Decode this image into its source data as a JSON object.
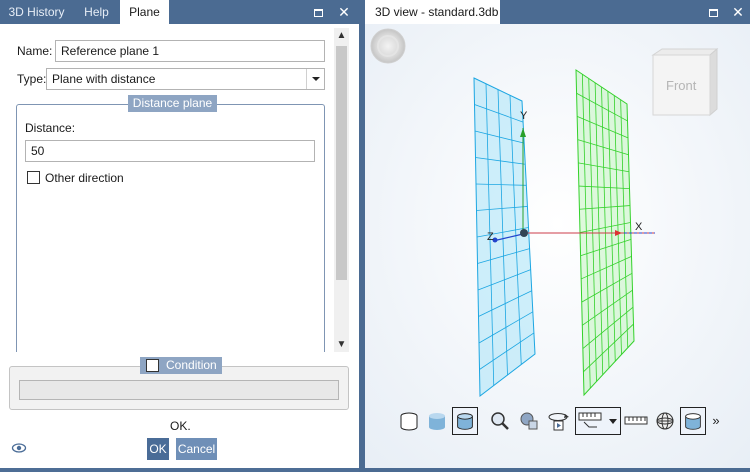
{
  "left_panel": {
    "tabs": [
      {
        "label": "3D History"
      },
      {
        "label": "Help"
      },
      {
        "label": "Plane"
      }
    ],
    "name_label": "Name:",
    "name_value": "Reference plane 1",
    "type_label": "Type:",
    "type_value": "Plane with distance",
    "group_title": "Distance plane",
    "distance_label": "Distance:",
    "distance_value": "50",
    "other_direction_label": "Other direction",
    "condition_label": "Condition",
    "status_text": "OK.",
    "ok_label": "OK",
    "cancel_label": "Cancel"
  },
  "right_panel": {
    "tab_title": "3D view - standard.3db",
    "view_cube_label": "Front",
    "axes": {
      "x": "X",
      "y": "Y",
      "z": "Z"
    },
    "toolbar_icons": [
      "cylinder-outline-icon",
      "cylinder-shaded-icon",
      "cylinder-shaded-outline-icon",
      "zoom-icon",
      "view-icon",
      "rotate-icon",
      "measure-dropdown-icon",
      "ruler-icon",
      "mesh-sphere-icon",
      "section-icon",
      "more-icon"
    ],
    "more_glyph": "»"
  },
  "colors": {
    "title_bar": "#4b6b92",
    "group_header": "#8ea5c3",
    "plane_blue": "#43b6e6",
    "plane_green": "#3fd93a",
    "axis_x": "#d83a3a",
    "axis_y": "#2aa02a",
    "axis_z": "#2244cc"
  }
}
